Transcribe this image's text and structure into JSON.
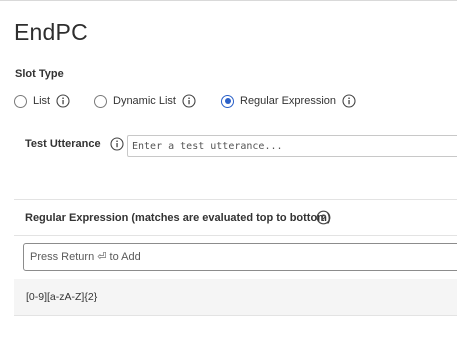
{
  "page": {
    "title": "EndPC"
  },
  "slot_type": {
    "label": "Slot Type",
    "options": [
      {
        "label": "List",
        "selected": false,
        "icon": "info-icon"
      },
      {
        "label": "Dynamic List",
        "selected": false,
        "icon": "info-icon"
      },
      {
        "label": "Regular Expression",
        "selected": true,
        "icon": "info-icon"
      }
    ]
  },
  "test_utterance": {
    "label": "Test Utterance",
    "icon": "info-icon",
    "placeholder": "Enter a test utterance...",
    "value": ""
  },
  "regex_section": {
    "header": "Regular Expression (matches are evaluated top to bottom)",
    "help_icon": "question-circle-icon",
    "add_placeholder": "Press Return ⏎ to Add",
    "expressions": [
      "[0-9][a-zA-Z]{2}"
    ]
  },
  "colors": {
    "accent": "#2a60c8",
    "row_background": "#f5f5f5",
    "divider": "#e3e3e3"
  }
}
